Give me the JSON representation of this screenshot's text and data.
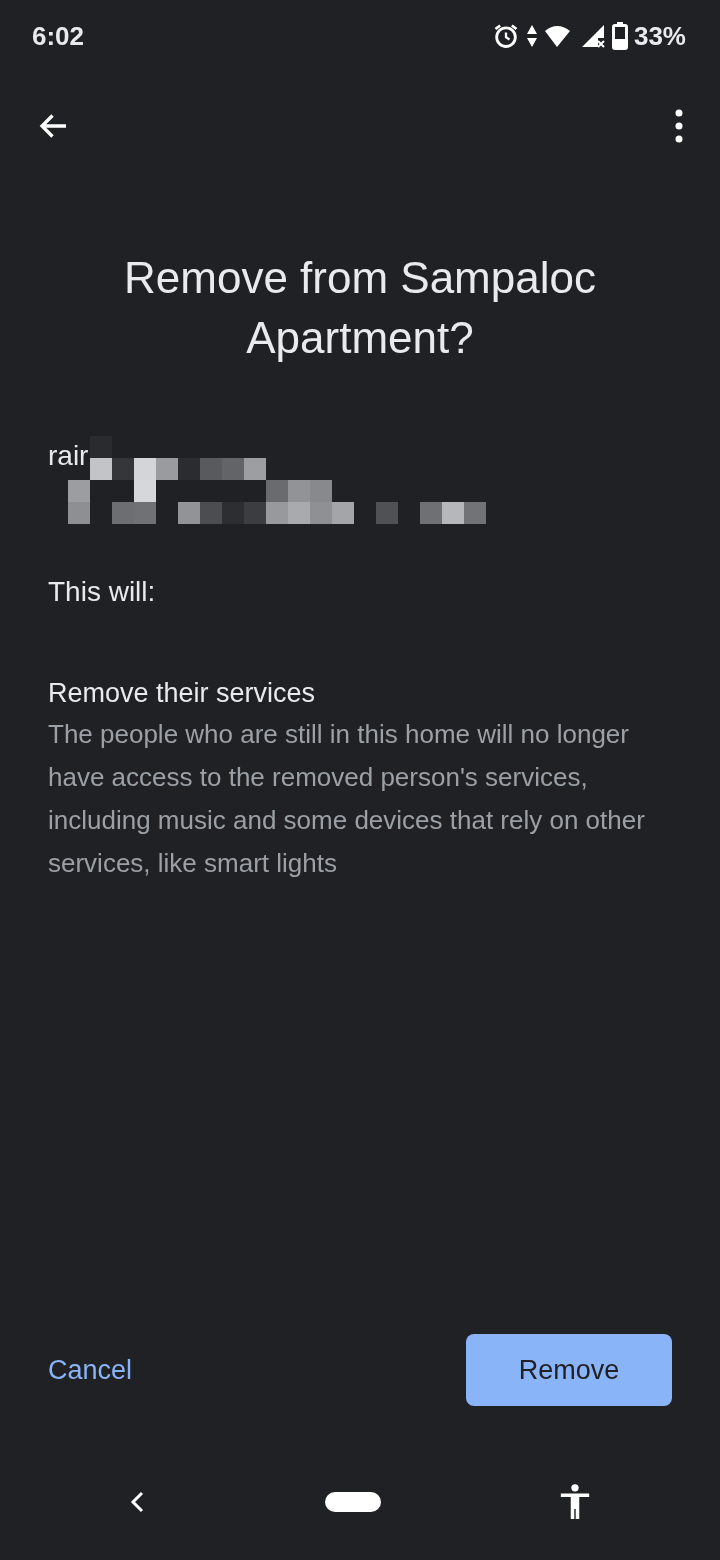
{
  "status_bar": {
    "time": "6:02",
    "battery": "33%"
  },
  "title": "Remove from Sampaloc Apartment?",
  "person": {
    "name": "rair"
  },
  "intro": "This will:",
  "consequence": {
    "heading": "Remove their services",
    "body": "The people who are still in this home will no longer have access to the removed person's services, including music and some devices that rely on other services, like smart lights"
  },
  "buttons": {
    "cancel": "Cancel",
    "confirm": "Remove"
  }
}
